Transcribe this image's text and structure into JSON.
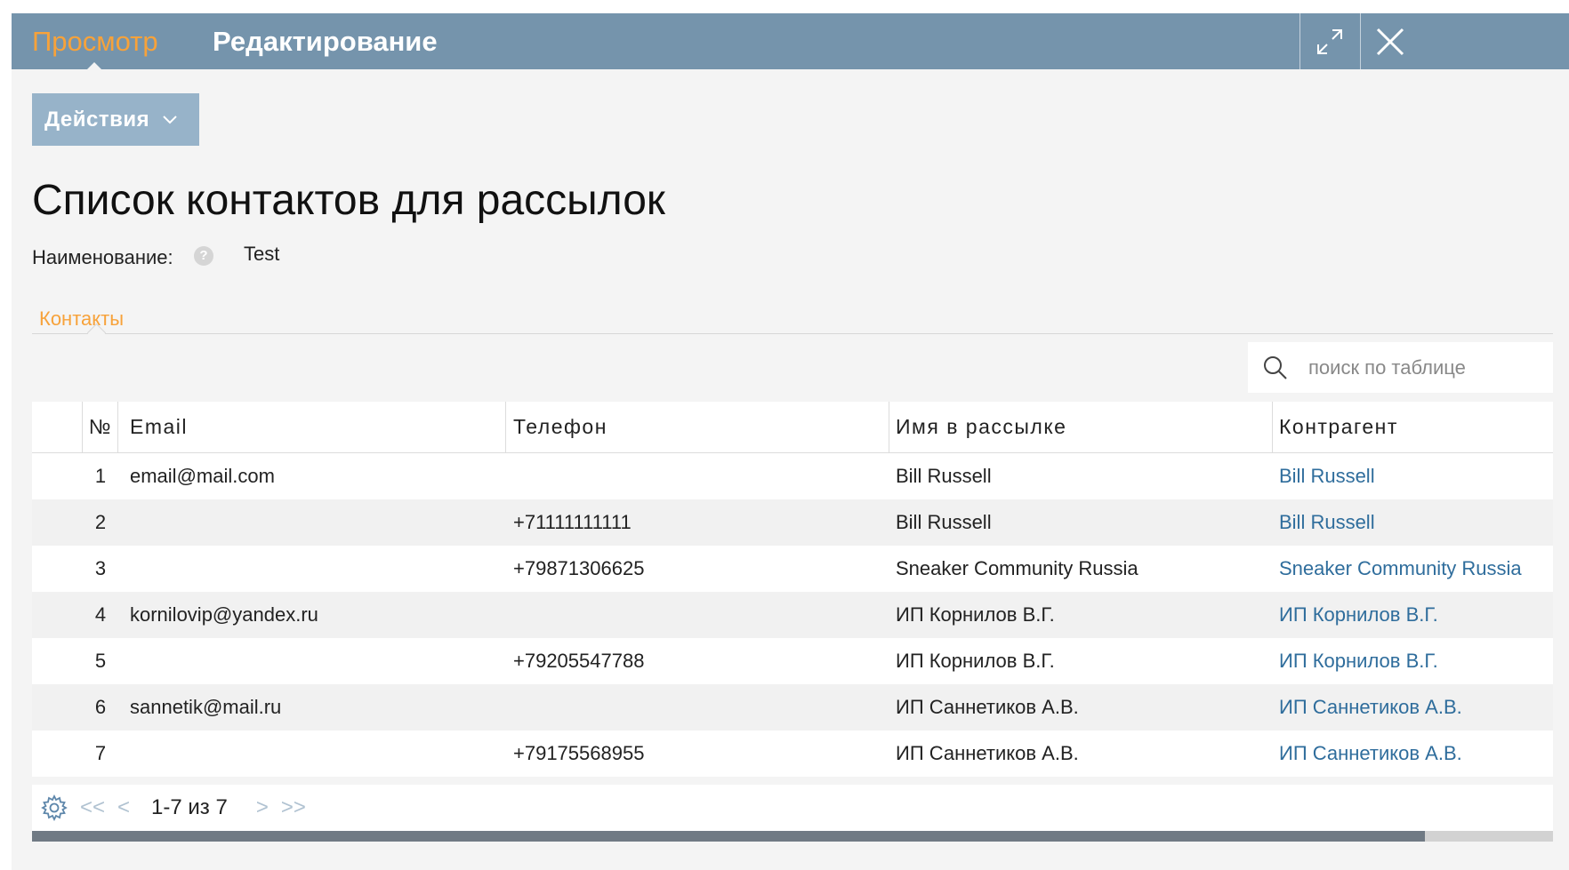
{
  "header": {
    "tabs": [
      {
        "label": "Просмотр",
        "active": true
      },
      {
        "label": "Редактирование",
        "active": false
      }
    ]
  },
  "actions": {
    "label": "Действия"
  },
  "page": {
    "title": "Список контактов для рассылок",
    "field_label": "Наименование:",
    "field_value": "Test",
    "subtab": "Контакты"
  },
  "search": {
    "placeholder": "поиск по таблице",
    "value": ""
  },
  "table": {
    "columns": [
      "№",
      "Email",
      "Телефон",
      "Имя в рассылке",
      "Контрагент"
    ],
    "rows": [
      {
        "num": "1",
        "email": "email@mail.com",
        "phone": "",
        "name": "Bill Russell",
        "agent": "Bill Russell"
      },
      {
        "num": "2",
        "email": "",
        "phone": "+71111111111",
        "name": "Bill Russell",
        "agent": "Bill Russell"
      },
      {
        "num": "3",
        "email": "",
        "phone": "+79871306625",
        "name": "Sneaker Community Russia",
        "agent": "Sneaker Community Russia"
      },
      {
        "num": "4",
        "email": "kornilovip@yandex.ru",
        "phone": "",
        "name": "ИП Корнилов В.Г.",
        "agent": "ИП Корнилов В.Г."
      },
      {
        "num": "5",
        "email": "",
        "phone": "+79205547788",
        "name": "ИП Корнилов В.Г.",
        "agent": "ИП Корнилов В.Г."
      },
      {
        "num": "6",
        "email": "sannetik@mail.ru",
        "phone": "",
        "name": "ИП Саннетиков А.В.",
        "agent": "ИП Саннетиков А.В."
      },
      {
        "num": "7",
        "email": "",
        "phone": "+79175568955",
        "name": "ИП Саннетиков А.В.",
        "agent": "ИП Саннетиков А.В."
      }
    ]
  },
  "pagination": {
    "first": "<<",
    "prev": "<",
    "info": "1-7 из 7",
    "next": ">",
    "last": ">>"
  },
  "colors": {
    "header_bg": "#7594ac",
    "accent": "#f7a23a",
    "link": "#2f6d9c",
    "button_bg": "#97b3c9"
  },
  "icons": [
    "expand-icon",
    "close-icon",
    "chevron-down-icon",
    "help-icon",
    "search-icon",
    "gear-icon"
  ],
  "scroll": {
    "visible_fraction": 0.916
  }
}
